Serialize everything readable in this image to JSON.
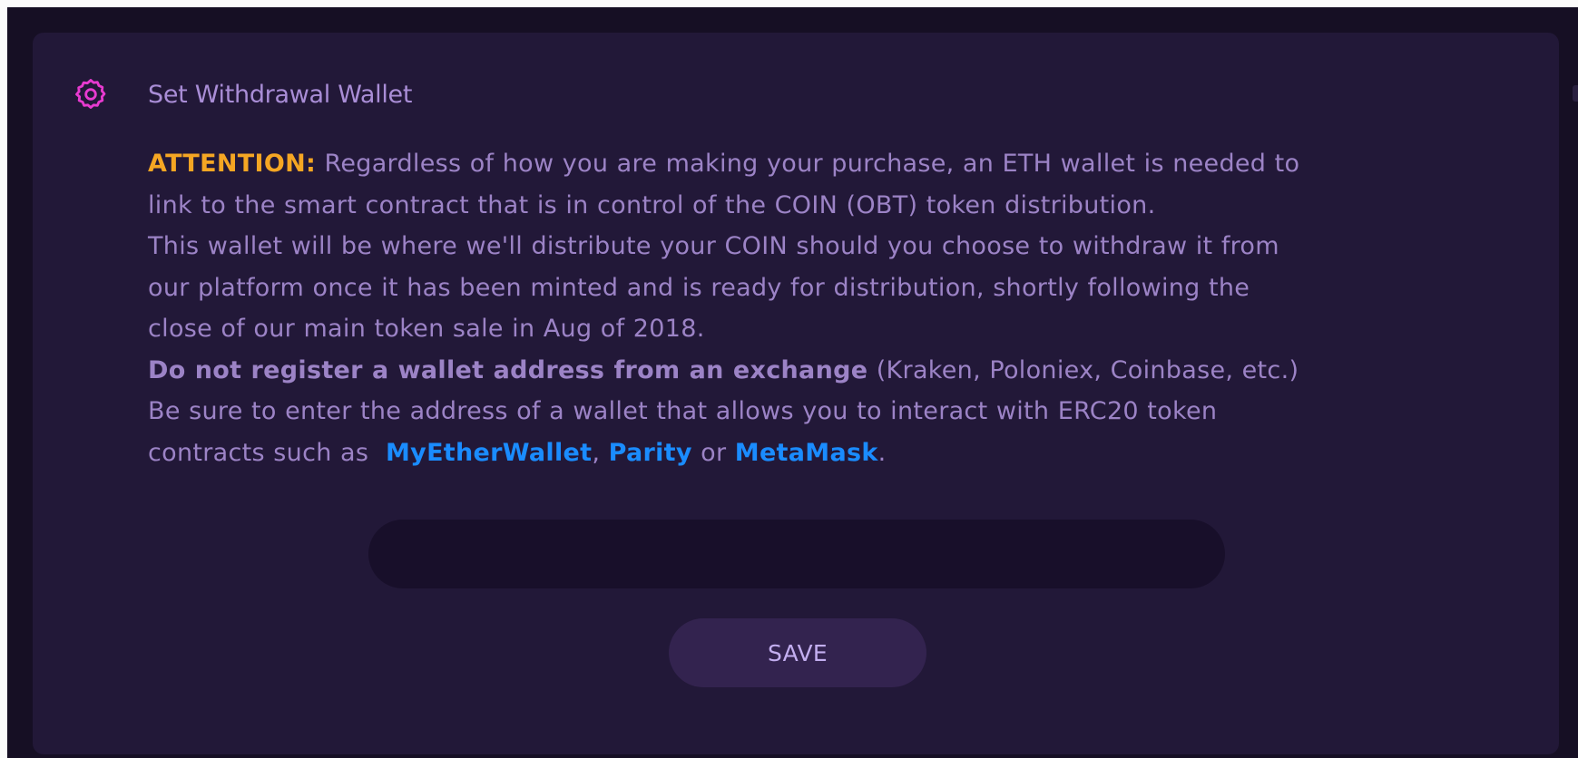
{
  "panel": {
    "title": "Set Withdrawal Wallet",
    "icon": "gear-icon",
    "accent_color": "#e83ad0"
  },
  "notice": {
    "attention_label": "ATTENTION:",
    "line1_rest": " Regardless of how you are making your purchase, an ETH wallet is needed to",
    "line2": "link to the smart contract that is in control of the COIN (OBT) token distribution.",
    "line3": "This wallet will be where we'll distribute your COIN should you choose to withdraw it from",
    "line4": "our platform once it has been minted and is ready for distribution, shortly following the",
    "line5": "close of our main token sale in Aug of 2018.",
    "warning_bold": "Do not register a wallet address from an exchange",
    "warning_rest": " (Kraken, Poloniex, Coinbase, etc.)",
    "line7": "Be sure to enter the address of a wallet that allows you to interact with ERC20 token",
    "line8_prefix": "contracts such as  ",
    "link1": "MyEtherWallet",
    "separator1": ", ",
    "link2": "Parity",
    "separator2": " or ",
    "link3": "MetaMask",
    "line8_suffix": "."
  },
  "wallet_input": {
    "value": "",
    "placeholder": ""
  },
  "save_button": {
    "label": "SAVE"
  },
  "colors": {
    "background": "#160f24",
    "panel": "#221838",
    "text": "#9c83c6",
    "attention": "#f5a623",
    "link": "#1a8cff",
    "button": "#33234f"
  }
}
